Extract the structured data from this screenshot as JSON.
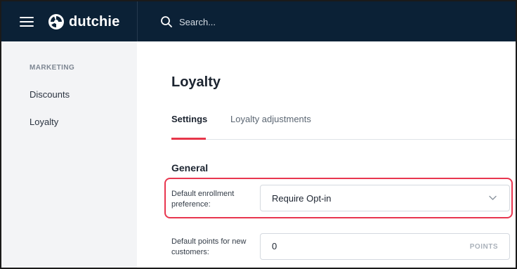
{
  "header": {
    "brand": "dutchie",
    "search_placeholder": "Search..."
  },
  "sidebar": {
    "section_label": "MARKETING",
    "items": [
      {
        "label": "Discounts"
      },
      {
        "label": "Loyalty"
      }
    ]
  },
  "main": {
    "title": "Loyalty",
    "tabs": [
      {
        "label": "Settings",
        "active": true
      },
      {
        "label": "Loyalty adjustments",
        "active": false
      }
    ],
    "section_title": "General",
    "fields": {
      "enrollment": {
        "label": "Default enrollment preference:",
        "value": "Require Opt-in"
      },
      "points": {
        "label": "Default points for new customers:",
        "value": "0",
        "suffix": "POINTS"
      }
    }
  },
  "colors": {
    "topbar": "#0b2136",
    "accent": "#e7364a",
    "sidebar_bg": "#f3f4f6"
  },
  "icons": [
    "menu-icon",
    "dutchie-logo-icon",
    "search-icon",
    "chevron-down-icon"
  ]
}
